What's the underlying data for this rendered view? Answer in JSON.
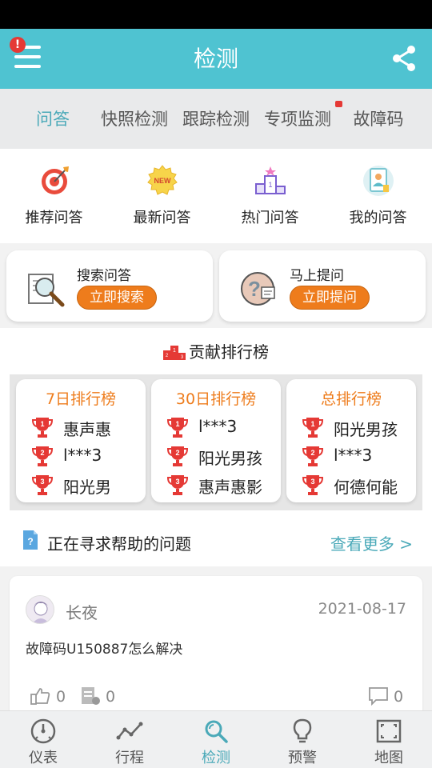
{
  "header": {
    "title": "检测",
    "alert_badge": "!"
  },
  "tabs": [
    {
      "label": "问答",
      "active": true
    },
    {
      "label": "快照检测"
    },
    {
      "label": "跟踪检测"
    },
    {
      "label": "专项监测",
      "badge": true
    },
    {
      "label": "故障码"
    }
  ],
  "quick_nav": [
    {
      "label": "推荐问答",
      "icon": "target-icon"
    },
    {
      "label": "最新问答",
      "icon": "new-badge-icon",
      "icon_text": "NEW"
    },
    {
      "label": "热门问答",
      "icon": "podium-icon"
    },
    {
      "label": "我的问答",
      "icon": "profile-card-icon"
    }
  ],
  "action_cards": {
    "search": {
      "title": "搜索问答",
      "button": "立即搜索"
    },
    "ask": {
      "title": "马上提问",
      "button": "立即提问"
    }
  },
  "ranking": {
    "title": "贡献排行榜",
    "boards": [
      {
        "title": "7日排行榜",
        "entries": [
          "惠声惠",
          "l***3",
          "阳光男"
        ]
      },
      {
        "title": "30日排行榜",
        "entries": [
          "l***3",
          "阳光男孩",
          "惠声惠影"
        ]
      },
      {
        "title": "总排行榜",
        "entries": [
          "阳光男孩",
          "l***3",
          "何德何能"
        ]
      }
    ],
    "ranks": [
      "1",
      "2",
      "3"
    ]
  },
  "help_section": {
    "title": "正在寻求帮助的问题",
    "more": "查看更多 >"
  },
  "post": {
    "user": "长夜",
    "date": "2021-08-17",
    "question": "故障码U150887怎么解决",
    "likes": "0",
    "answers": "0",
    "comments": "0"
  },
  "bottom_nav": [
    {
      "label": "仪表",
      "icon": "gauge-icon"
    },
    {
      "label": "行程",
      "icon": "route-icon"
    },
    {
      "label": "检测",
      "icon": "scan-search-icon",
      "active": true
    },
    {
      "label": "预警",
      "icon": "lightbulb-icon"
    },
    {
      "label": "地图",
      "icon": "map-frame-icon"
    }
  ],
  "colors": {
    "accent": "#4fc3d1",
    "accent_text": "#4aa9b8",
    "orange": "#ee7c1c",
    "alert": "#e53935"
  }
}
